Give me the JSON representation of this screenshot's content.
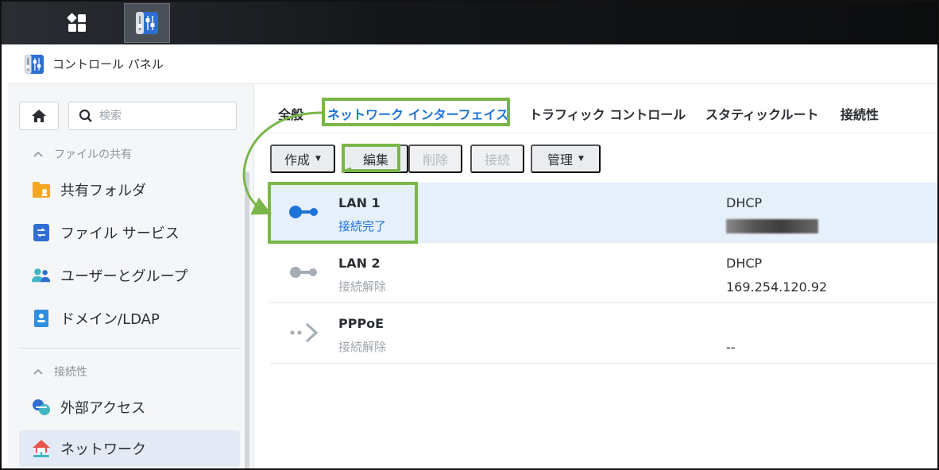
{
  "window": {
    "title": "コントロール パネル"
  },
  "sidebar": {
    "search_placeholder": "検索",
    "sections": [
      {
        "label": "ファイルの共有"
      },
      {
        "label": "接続性"
      }
    ],
    "items": [
      {
        "label": "共有フォルダ",
        "icon": "shared-folder-icon"
      },
      {
        "label": "ファイル サービス",
        "icon": "file-services-icon"
      },
      {
        "label": "ユーザーとグループ",
        "icon": "users-groups-icon"
      },
      {
        "label": "ドメイン/LDAP",
        "icon": "domain-ldap-icon"
      },
      {
        "label": "外部アクセス",
        "icon": "external-access-icon"
      },
      {
        "label": "ネットワーク",
        "icon": "network-icon",
        "active": true
      }
    ]
  },
  "tabs": [
    {
      "label": "全般"
    },
    {
      "label": "ネットワーク インターフェイス",
      "active": true
    },
    {
      "label": "トラフィック コントロール"
    },
    {
      "label": "スタティックルート"
    },
    {
      "label": "接続性"
    }
  ],
  "toolbar": {
    "create_label": "作成",
    "edit_label": "編集",
    "delete_label": "削除",
    "connect_label": "接続",
    "manage_label": "管理"
  },
  "interfaces": [
    {
      "name": "LAN 1",
      "status": "接続完了",
      "type": "DHCP",
      "ip": ""
    },
    {
      "name": "LAN 2",
      "status": "接続解除",
      "type": "DHCP",
      "ip": "169.254.120.92"
    },
    {
      "name": "PPPoE",
      "status": "接続解除",
      "type": "",
      "ip": "--"
    }
  ],
  "colors": {
    "accent": "#1e73d8",
    "highlight": "#7ab648",
    "selected_row": "#e6f0fb"
  }
}
